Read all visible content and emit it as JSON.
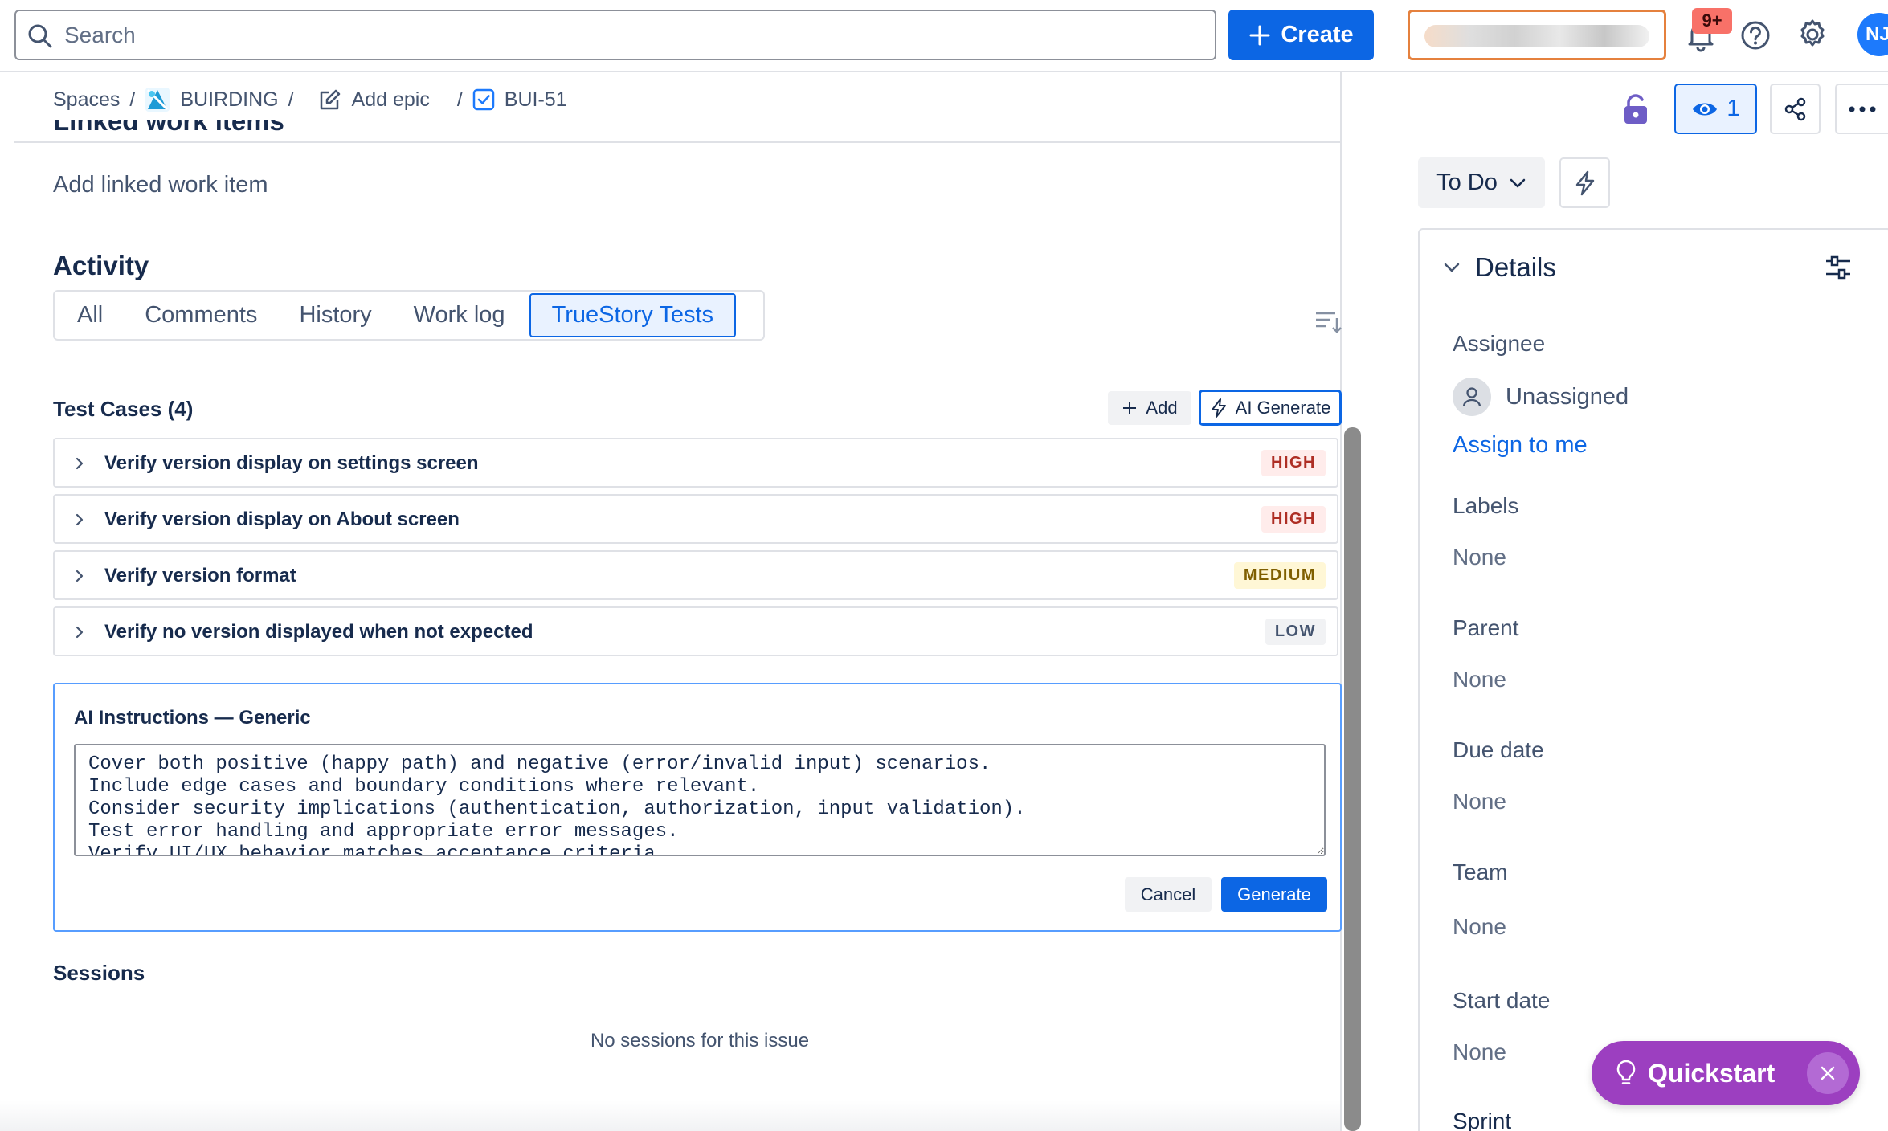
{
  "topbar": {
    "search_placeholder": "Search",
    "create_label": "Create",
    "notifications_badge": "9+",
    "avatar_initials": "NJ"
  },
  "breadcrumb": {
    "spaces": "Spaces",
    "project": "BUIRDING",
    "epic": "Add epic",
    "issue": "BUI-51"
  },
  "linked": {
    "heading": "Linked work items",
    "add_label": "Add linked work item"
  },
  "activity": {
    "title": "Activity",
    "tabs": [
      "All",
      "Comments",
      "History",
      "Work log",
      "TrueStory Tests"
    ],
    "active_tab": "TrueStory Tests"
  },
  "test_cases": {
    "title": "Test Cases (4)",
    "add_label": "Add",
    "ai_generate_label": "AI Generate",
    "items": [
      {
        "name": "Verify version display on settings screen",
        "priority": "HIGH"
      },
      {
        "name": "Verify version display on About screen",
        "priority": "HIGH"
      },
      {
        "name": "Verify version format",
        "priority": "MEDIUM"
      },
      {
        "name": "Verify no version displayed when not expected",
        "priority": "LOW"
      }
    ]
  },
  "ai_instructions": {
    "title": "AI Instructions — Generic",
    "text": "Cover both positive (happy path) and negative (error/invalid input) scenarios.\nInclude edge cases and boundary conditions where relevant.\nConsider security implications (authentication, authorization, input validation).\nTest error handling and appropriate error messages.\nVerify UI/UX behavior matches acceptance criteria.",
    "cancel_label": "Cancel",
    "generate_label": "Generate"
  },
  "sessions": {
    "title": "Sessions",
    "empty_text": "No sessions for this issue"
  },
  "right_panel": {
    "watchers_count": "1",
    "status_label": "To Do",
    "details_title": "Details",
    "fields": {
      "assignee_label": "Assignee",
      "assignee_value": "Unassigned",
      "assign_to_me": "Assign to me",
      "labels_label": "Labels",
      "labels_value": "None",
      "parent_label": "Parent",
      "parent_value": "None",
      "due_date_label": "Due date",
      "due_date_value": "None",
      "team_label": "Team",
      "team_value": "None",
      "start_date_label": "Start date",
      "start_date_value": "None",
      "sprint_label": "Sprint"
    }
  },
  "quickstart": {
    "label": "Quickstart"
  },
  "colors": {
    "brand_blue": "#0c66e4",
    "high": "#ae2e24",
    "medium": "#7f5f01",
    "quickstart": "#9c3fc0",
    "trial_border": "#e5813e"
  }
}
